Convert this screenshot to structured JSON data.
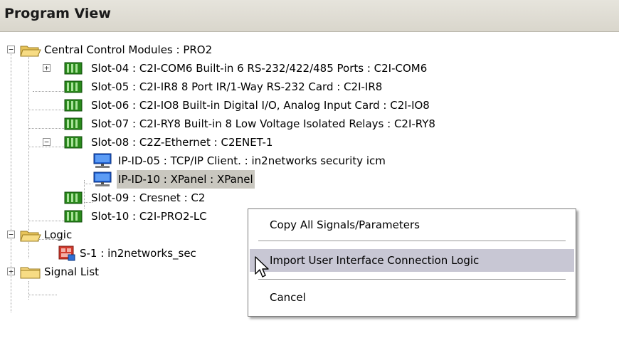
{
  "panel": {
    "title": "Program View"
  },
  "tree": {
    "central": {
      "label": "Central Control Modules : PRO2"
    },
    "slot04": {
      "label": "Slot-04 : C2I-COM6 Built-in 6 RS-232/422/485 Ports : C2I-COM6"
    },
    "slot05": {
      "label": "Slot-05 : C2I-IR8 8 Port IR/1-Way RS-232 Card : C2I-IR8"
    },
    "slot06": {
      "label": "Slot-06 : C2I-IO8 Built-in Digital I/O, Analog Input Card : C2I-IO8"
    },
    "slot07": {
      "label": "Slot-07 : C2I-RY8 Built-in 8 Low Voltage Isolated Relays : C2I-RY8"
    },
    "slot08": {
      "label": "Slot-08 : C2Z-Ethernet : C2ENET-1"
    },
    "ipid05": {
      "label": "IP-ID-05 : TCP/IP Client. : in2networks security icm"
    },
    "ipid10": {
      "label": "IP-ID-10 : XPanel : XPanel"
    },
    "slot09": {
      "label": "Slot-09 : Cresnet : C2"
    },
    "slot10": {
      "label": "Slot-10 : C2I-PRO2-LC"
    },
    "logic": {
      "label": "Logic"
    },
    "s1": {
      "label": "S-1 : in2networks_sec"
    },
    "signals": {
      "label": "Signal List"
    }
  },
  "context_menu": {
    "items": [
      {
        "label": "Copy All Signals/Parameters"
      },
      {
        "label": "Import User Interface Connection Logic"
      },
      {
        "label": "Cancel"
      }
    ]
  },
  "colors": {
    "selection": "#c9c7bf",
    "menu_highlight": "#c8c7d4",
    "folder": "#f3d37a",
    "card": "#2a8a1c"
  }
}
